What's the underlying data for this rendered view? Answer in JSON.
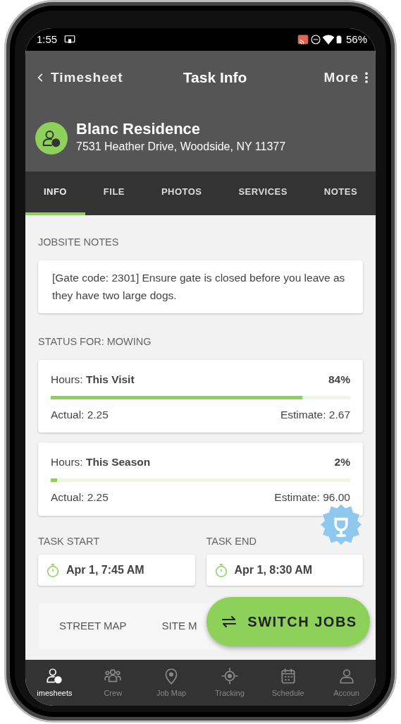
{
  "status_bar": {
    "time": "1:55",
    "battery": "56%"
  },
  "app_bar": {
    "back": "Timesheet",
    "title": "Task Info",
    "more": "More"
  },
  "job": {
    "name": "Blanc Residence",
    "address": "7531 Heather Drive, Woodside, NY 11377"
  },
  "tabs": [
    {
      "label": "INFO",
      "selected": true
    },
    {
      "label": "FILE",
      "selected": false
    },
    {
      "label": "PHOTOS",
      "selected": false
    },
    {
      "label": "SERVICES",
      "selected": false
    },
    {
      "label": "NOTES",
      "selected": false
    }
  ],
  "jobsite_notes": {
    "heading": "JOBSITE NOTES",
    "text": "[Gate code: 2301] Ensure gate is closed before you leave as they have two large dogs."
  },
  "status": {
    "heading": "STATUS FOR: MOWING",
    "cards": [
      {
        "label": "Hours: **This Visit**",
        "percent": "84%",
        "level": 0.84,
        "actual": "Actual: 2.25",
        "estimate": "Estimate: 2.67"
      },
      {
        "label": "Hours: **This Season**",
        "percent": "2%",
        "level": 0.02,
        "actual": "Actual: 2.25",
        "estimate": "Estimate: 96.00"
      }
    ]
  },
  "task_times": [
    {
      "heading": "TASK START",
      "value": "Apr 1, 7:45 AM"
    },
    {
      "heading": "TASK END",
      "value": "Apr 1, 8:30 AM"
    }
  ],
  "map_tabs": [
    {
      "label": "STREET MAP"
    },
    {
      "label": "SITE M"
    }
  ],
  "fab": {
    "label": "SWITCH JOBS"
  },
  "bottom_nav": [
    {
      "label": "imesheets",
      "selected": true
    },
    {
      "label": "Crew",
      "selected": false
    },
    {
      "label": "Job Map",
      "selected": false
    },
    {
      "label": "Tracking",
      "selected": false
    },
    {
      "label": "Schedule",
      "selected": false
    },
    {
      "label": "Accoun",
      "selected": false
    }
  ]
}
